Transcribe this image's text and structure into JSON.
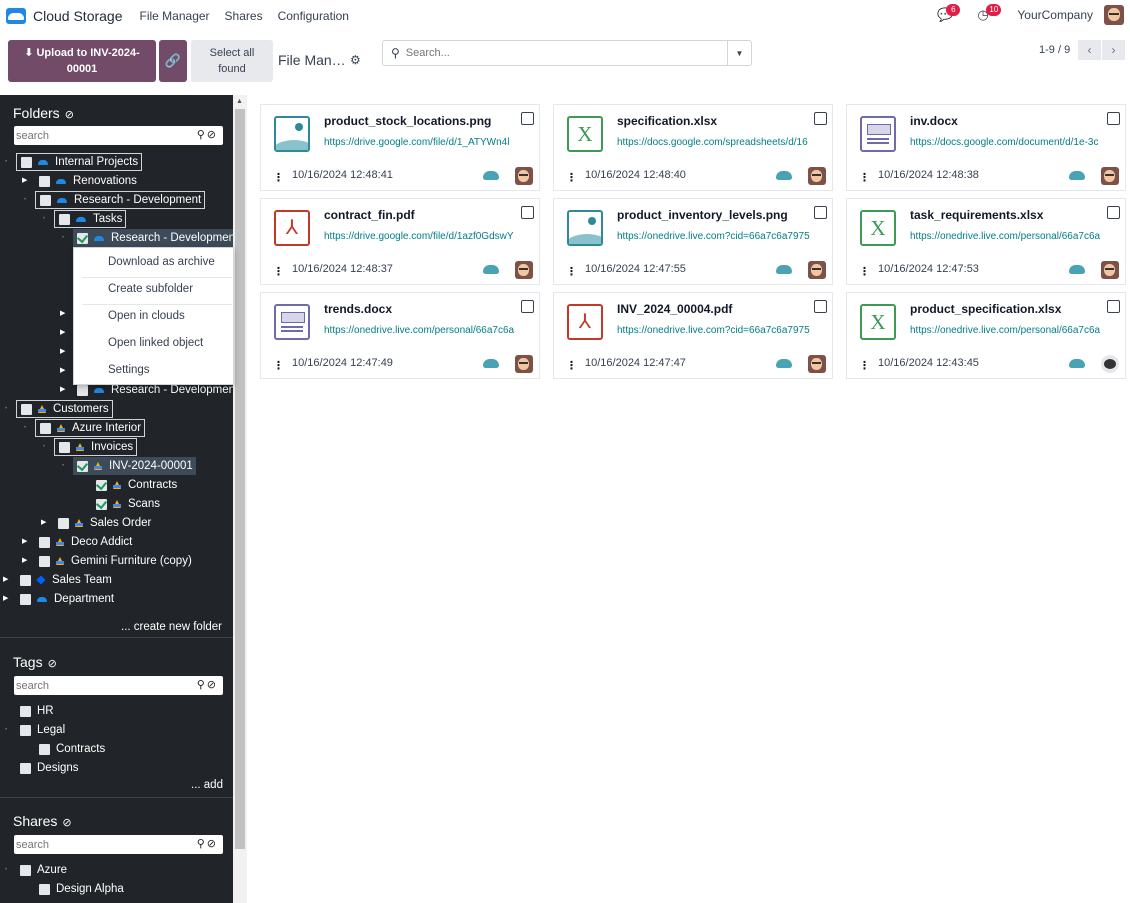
{
  "navbar": {
    "app_title": "Cloud Storage",
    "menu": [
      "File Manager",
      "Shares",
      "Configuration"
    ],
    "messages_count": "6",
    "activities_count": "10",
    "company": "YourCompany"
  },
  "toolbar": {
    "upload_label_line1": "⬇ Upload to INV-2024-",
    "upload_label_line2": "00001",
    "link_icon": "🔗",
    "select_all_line1": "Select all",
    "select_all_line2": "found",
    "breadcrumb": "File Man…",
    "search_placeholder": "Search...",
    "pager": "1-9 / 9"
  },
  "folders": {
    "title": "Folders",
    "search_placeholder": "search",
    "tree": [
      {
        "label": "Internal Projects",
        "cloud": "od"
      },
      {
        "label": "Renovations",
        "cloud": "od"
      },
      {
        "label": "Research - Development",
        "cloud": "od"
      },
      {
        "label": "Tasks",
        "cloud": "od"
      },
      {
        "label": "Research - Development",
        "cloud": "od"
      },
      {
        "label": "Research - Development",
        "cloud": "od"
      },
      {
        "label": "Customers",
        "cloud": "gd"
      },
      {
        "label": "Azure Interior",
        "cloud": "gd"
      },
      {
        "label": "Invoices",
        "cloud": "gd"
      },
      {
        "label": "INV-2024-00001",
        "cloud": "gd"
      },
      {
        "label": "Contracts",
        "cloud": "gd"
      },
      {
        "label": "Scans",
        "cloud": "gd"
      },
      {
        "label": "Sales Order",
        "cloud": "gd"
      },
      {
        "label": "Deco Addict",
        "cloud": "gd"
      },
      {
        "label": "Gemini Furniture (copy)",
        "cloud": "gd"
      },
      {
        "label": "Sales Team",
        "cloud": "db"
      },
      {
        "label": "Department",
        "cloud": "od"
      }
    ],
    "create_folder": "... create new folder"
  },
  "context_menu": [
    "Download as archive",
    "Create subfolder",
    "Open in clouds",
    "Open linked object",
    "Settings"
  ],
  "tags": {
    "title": "Tags",
    "search_placeholder": "search",
    "items": [
      "HR",
      "Legal",
      "Contracts",
      "Designs"
    ],
    "add": "... add"
  },
  "shares": {
    "title": "Shares",
    "search_placeholder": "search",
    "items": [
      "Azure",
      "Design Alpha"
    ]
  },
  "files": [
    {
      "name": "product_stock_locations.png",
      "url": "https://drive.google.com/file/d/1_ATYWn4l",
      "date": "10/16/2024 12:48:41",
      "type": "img"
    },
    {
      "name": "specification.xlsx",
      "url": "https://docs.google.com/spreadsheets/d/16",
      "date": "10/16/2024 12:48:40",
      "type": "xls"
    },
    {
      "name": "inv.docx",
      "url": "https://docs.google.com/document/d/1e-3c",
      "date": "10/16/2024 12:48:38",
      "type": "doc"
    },
    {
      "name": "contract_fin.pdf",
      "url": "https://drive.google.com/file/d/1azf0GdswY",
      "date": "10/16/2024 12:48:37",
      "type": "pdf"
    },
    {
      "name": "product_inventory_levels.png",
      "url": "https://onedrive.live.com?cid=66a7c6a7975",
      "date": "10/16/2024 12:47:55",
      "type": "img"
    },
    {
      "name": "task_requirements.xlsx",
      "url": "https://onedrive.live.com/personal/66a7c6a",
      "date": "10/16/2024 12:47:53",
      "type": "xls"
    },
    {
      "name": "trends.docx",
      "url": "https://onedrive.live.com/personal/66a7c6a",
      "date": "10/16/2024 12:47:49",
      "type": "doc"
    },
    {
      "name": "INV_2024_00004.pdf",
      "url": "https://onedrive.live.com?cid=66a7c6a7975",
      "date": "10/16/2024 12:47:47",
      "type": "pdf"
    },
    {
      "name": "product_specification.xlsx",
      "url": "https://onedrive.live.com/personal/66a7c6a",
      "date": "10/16/2024 12:43:45",
      "type": "xls"
    }
  ]
}
